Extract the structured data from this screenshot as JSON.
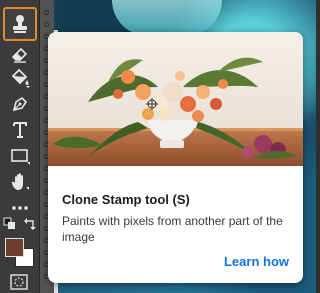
{
  "toolbar": {
    "tools": [
      {
        "name": "clone-stamp-tool",
        "icon": "stamp-icon",
        "active": true
      },
      {
        "name": "eraser-tool",
        "icon": "eraser-icon",
        "active": false
      },
      {
        "name": "paint-bucket-tool",
        "icon": "paint-bucket-icon",
        "active": false
      },
      {
        "name": "pen-tool",
        "icon": "pen-icon",
        "active": false
      },
      {
        "name": "type-tool",
        "icon": "type-icon",
        "active": false
      },
      {
        "name": "rectangle-tool",
        "icon": "rectangle-icon",
        "active": false
      },
      {
        "name": "hand-tool",
        "icon": "hand-icon",
        "active": false
      },
      {
        "name": "more-tools",
        "icon": "ellipsis-icon",
        "active": false
      }
    ],
    "active_outline_color": "#e08a2c",
    "foreground_color": "#6e3c2c",
    "background_color": "#ffffff"
  },
  "tooltip": {
    "image_alt": "Flower arrangement on a wooden table",
    "title": "Clone Stamp tool (S)",
    "description": "Paints with pixels from another part of the image",
    "link_label": "Learn how",
    "link_color": "#1473e6"
  }
}
